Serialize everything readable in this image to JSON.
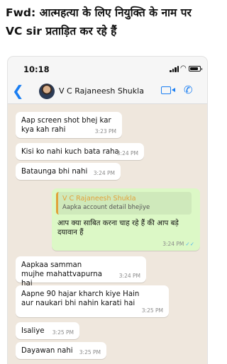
{
  "caption": "Fwd: आत्महत्या के लिए नियुक्ति के नाम पर VC sir प्रताड़ित कर रहे हैं",
  "status_bar": {
    "time": "10:18"
  },
  "chat_header": {
    "contact_name": "V C Rajaneesh Shukla",
    "icons": [
      "back-arrow-icon",
      "video-call-icon",
      "phone-call-icon"
    ]
  },
  "messages": [
    {
      "text": "Aap screen shot bhej kar kya kah rahi",
      "time": "3:23 PM"
    },
    {
      "text": "Kisi ko nahi kuch bata raha",
      "time": "3:24 PM"
    },
    {
      "text": "Bataunga bhi nahi",
      "time": "3:24 PM"
    },
    {
      "quote_name": "V C Rajaneesh Shukla",
      "quote_text": "Aapka account detail bhejiye",
      "text": "आप क्या साबित करना चाह रहे हैं की आप बड़े दयावान हैं",
      "time": "3:24 PM",
      "ticks": "✓✓"
    },
    {
      "text": "Aapkaa samman mujhe mahattvapurna hai",
      "time": "3:24 PM"
    },
    {
      "text": "Aapne 90 hajar kharch kiye Hain aur naukari bhi nahin karati hai",
      "time": "3:25 PM"
    },
    {
      "text": "Isaliye",
      "time": "3:25 PM"
    },
    {
      "text": "Dayawan nahi",
      "time": "3:25 PM"
    }
  ],
  "colors": {
    "chat_background": "#efe7dd",
    "outgoing_bubble": "#dcf8c6",
    "incoming_bubble": "#ffffff",
    "accent_blue": "#1a7ef2",
    "quote_name": "#e1a23a"
  }
}
